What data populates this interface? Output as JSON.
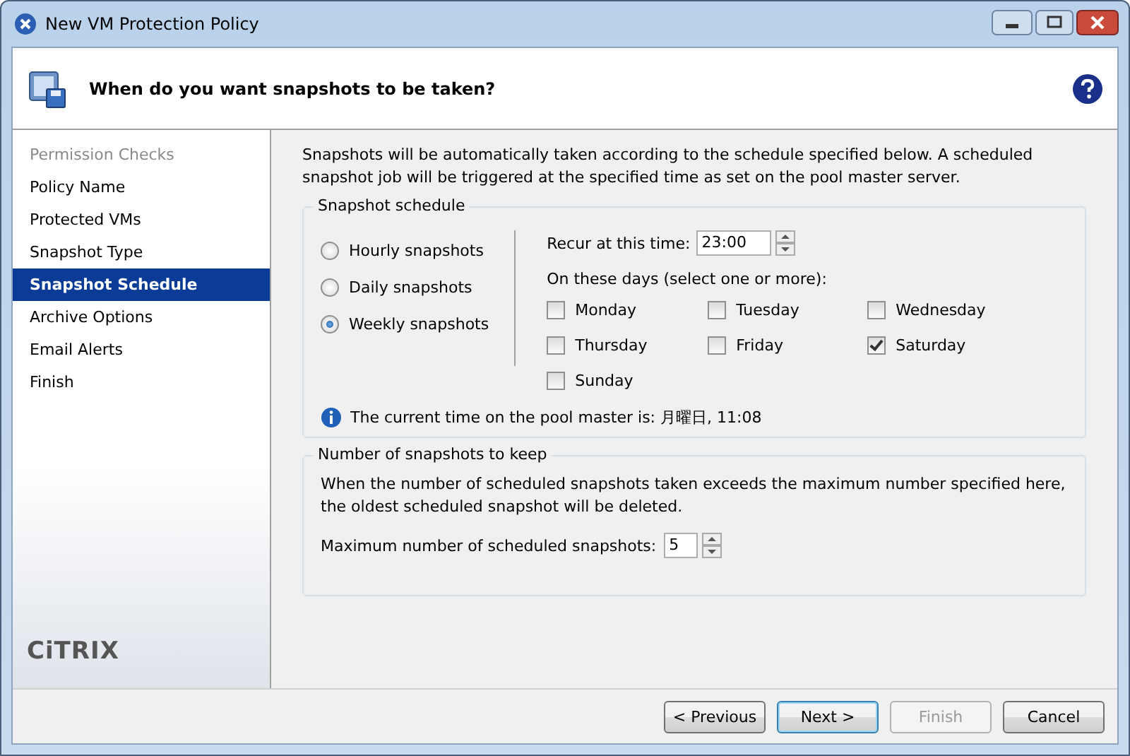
{
  "window": {
    "title": "New VM Protection Policy"
  },
  "header": {
    "title": "When do you want snapshots to be taken?"
  },
  "sidebar": {
    "items": [
      {
        "label": "Permission Checks",
        "disabled": true,
        "selected": false
      },
      {
        "label": "Policy Name",
        "disabled": false,
        "selected": false
      },
      {
        "label": "Protected VMs",
        "disabled": false,
        "selected": false
      },
      {
        "label": "Snapshot Type",
        "disabled": false,
        "selected": false
      },
      {
        "label": "Snapshot Schedule",
        "disabled": false,
        "selected": true
      },
      {
        "label": "Archive Options",
        "disabled": false,
        "selected": false
      },
      {
        "label": "Email Alerts",
        "disabled": false,
        "selected": false
      },
      {
        "label": "Finish",
        "disabled": false,
        "selected": false
      }
    ],
    "logo": "CiTRIX"
  },
  "intro": "Snapshots will be automatically taken according to the schedule specified below. A scheduled snapshot job will be triggered at the specified time as set on the pool master server.",
  "schedule": {
    "title": "Snapshot schedule",
    "frequencies": [
      {
        "label": "Hourly snapshots",
        "selected": false
      },
      {
        "label": "Daily snapshots",
        "selected": false
      },
      {
        "label": "Weekly snapshots",
        "selected": true
      }
    ],
    "recur_label": "Recur at this time:",
    "recur_value": "23:00",
    "days_label": "On these days (select one or more):",
    "days": [
      {
        "label": "Monday",
        "checked": false
      },
      {
        "label": "Tuesday",
        "checked": false
      },
      {
        "label": "Wednesday",
        "checked": false
      },
      {
        "label": "Thursday",
        "checked": false
      },
      {
        "label": "Friday",
        "checked": false
      },
      {
        "label": "Saturday",
        "checked": true
      },
      {
        "label": "Sunday",
        "checked": false
      }
    ],
    "current_time": "The current time on the pool master is: 月曜日, 11:08"
  },
  "retention": {
    "title": "Number of snapshots to keep",
    "description": "When the number of scheduled snapshots taken exceeds the maximum number specified here, the oldest scheduled snapshot will be deleted.",
    "max_label": "Maximum number of scheduled snapshots:",
    "max_value": "5"
  },
  "buttons": [
    {
      "label": "< Previous",
      "disabled": false,
      "default": false
    },
    {
      "label": "Next >",
      "disabled": false,
      "default": true
    },
    {
      "label": "Finish",
      "disabled": true,
      "default": false
    },
    {
      "label": "Cancel",
      "disabled": false,
      "default": false
    }
  ]
}
